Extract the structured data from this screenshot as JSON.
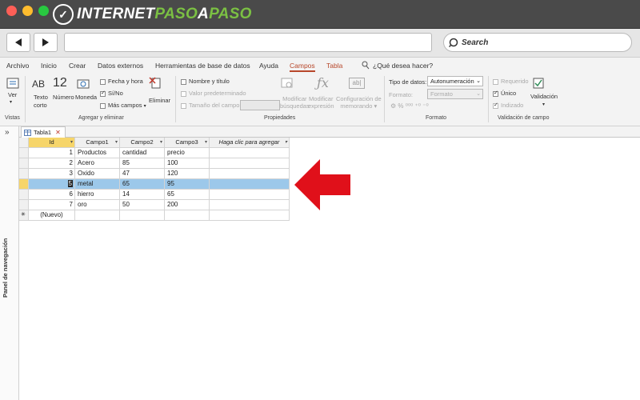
{
  "browser": {
    "logo_text_a": "INTERNET",
    "logo_text_b": "PASO",
    "logo_text_c": "A",
    "logo_text_d": "PASO",
    "search_label": "Search"
  },
  "menu": {
    "items": [
      "Archivo",
      "Inicio",
      "Crear",
      "Datos externos",
      "Herramientas de base de datos",
      "Ayuda",
      "Campos",
      "Tabla"
    ],
    "active": "Campos",
    "tell_me": "¿Qué desea hacer?"
  },
  "ribbon": {
    "vistas": {
      "ver_label": "Ver",
      "group": "Vistas"
    },
    "agregar": {
      "ab_icon": "AB",
      "texto_corto": [
        "Texto",
        "corto"
      ],
      "num_icon": "12",
      "numero": "Número",
      "moneda": "Moneda",
      "fecha_hora": "Fecha y hora",
      "si_no": "Sí/No",
      "mas_campos": "Más campos",
      "eliminar": "Eliminar",
      "group": "Agregar y eliminar"
    },
    "propiedades": {
      "nombre_titulo": "Nombre y título",
      "valor_predeterminado": "Valor predeterminado",
      "tamano_campo": "Tamaño del campo",
      "modificar_busquedas": [
        "Modificar",
        "búsquedas"
      ],
      "modificar_expresion": [
        "Modificar",
        "expresión"
      ],
      "configuracion_memorando": [
        "Configuración de",
        "memorando"
      ],
      "group": "Propiedades"
    },
    "formato": {
      "tipo_datos_label": "Tipo de datos:",
      "tipo_datos_value": "Autonumeración",
      "formato_label": "Formato:",
      "formato_value": "Formato",
      "group": "Formato"
    },
    "validacion": {
      "requerido": "Requerido",
      "unico": "Único",
      "indizado": "Indizado",
      "validacion_btn": "Validación",
      "group": "Validación de campo"
    }
  },
  "panel": {
    "label": "Panel de navegación",
    "collapse": "»"
  },
  "table": {
    "tab_name": "Tabla1",
    "headers": [
      "Id",
      "Campo1",
      "Campo2",
      "Campo3",
      "Haga clic para agregar"
    ],
    "rows": [
      [
        "1",
        "Productos",
        "cantidad",
        "precio"
      ],
      [
        "2",
        "Acero",
        "85",
        "100"
      ],
      [
        "3",
        "Oxido",
        "47",
        "120"
      ],
      [
        "5",
        "metal",
        "65",
        "95"
      ],
      [
        "6",
        "hierro",
        "14",
        "65"
      ],
      [
        "7",
        "oro",
        "50",
        "200"
      ]
    ],
    "selected_row": 3,
    "new_row_label": "(Nuevo)",
    "new_row_marker": "✳"
  },
  "colors": {
    "accent": "#b7472a",
    "selection": "#9cc8ea",
    "arrow": "#e0101a",
    "header_highlight": "#f6d56a"
  }
}
